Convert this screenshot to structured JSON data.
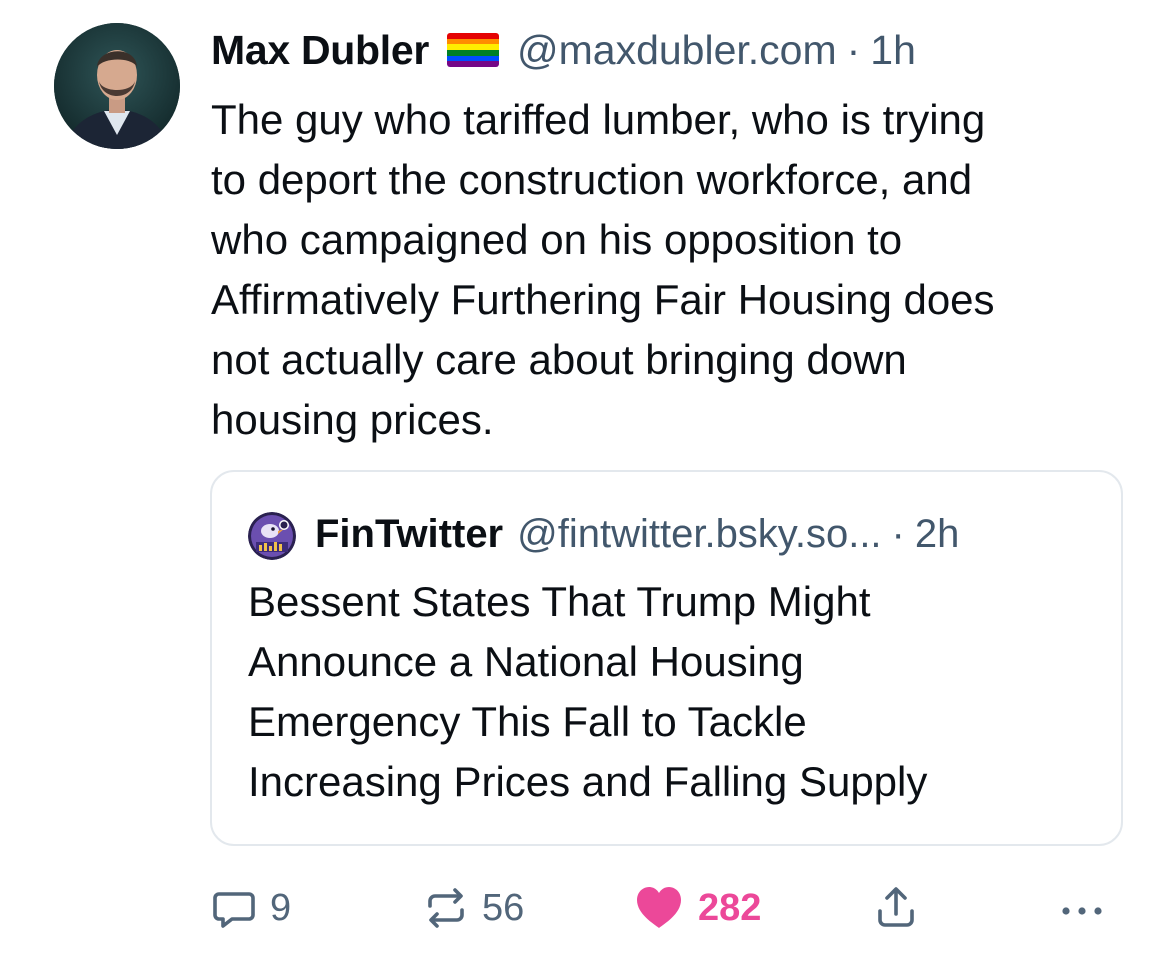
{
  "post": {
    "author": {
      "display_name": "Max Dubler",
      "handle": "@maxdubler.com",
      "time": "1h",
      "flag_icon": "rainbow-flag-icon",
      "flag_colors": [
        "#e40303",
        "#ff8c00",
        "#ffed00",
        "#008026",
        "#004dff",
        "#750787"
      ]
    },
    "separator": "·",
    "text": "The guy who tariffed lumber, who is trying\nto deport the construction workforce, and\nwho campaigned on his opposition to\nAffirmatively Furthering Fair Housing does\nnot actually care about bringing down\nhousing prices.",
    "quote": {
      "display_name": "FinTwitter",
      "handle": "@fintwitter.bsky.so...",
      "time": "2h",
      "text": "Bessent States That Trump Might\nAnnounce a National Housing\nEmergency This Fall to Tackle\nIncreasing Prices and Falling Supply"
    },
    "actions": {
      "reply_count": "9",
      "repost_count": "56",
      "like_count": "282",
      "like_color": "#ec4899",
      "icons": [
        "reply-icon",
        "repost-icon",
        "heart-icon",
        "share-icon",
        "more-icon"
      ]
    }
  }
}
